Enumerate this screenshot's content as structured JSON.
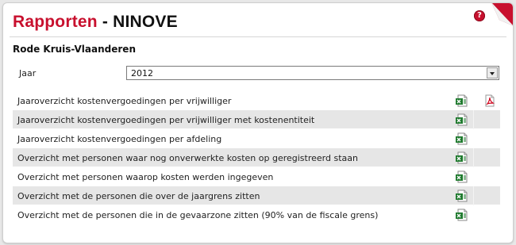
{
  "header": {
    "title_main": "Rapporten",
    "title_separator": "-",
    "title_location": "NINOVE"
  },
  "organization": "Rode Kruis-Vlaanderen",
  "filter": {
    "year_label": "Jaar",
    "year_value": "2012"
  },
  "reports": [
    {
      "label": "Jaaroverzicht kostenvergoedingen per vrijwilliger",
      "excel": true,
      "pdf": true
    },
    {
      "label": "Jaaroverzicht kostenvergoedingen per vrijwilliger met kostenentiteit",
      "excel": true,
      "pdf": false
    },
    {
      "label": "Jaaroverzicht kostenvergoedingen per afdeling",
      "excel": true,
      "pdf": false
    },
    {
      "label": "Overzicht met personen waar nog onverwerkte kosten op geregistreerd staan",
      "excel": true,
      "pdf": false
    },
    {
      "label": "Overzicht met personen waarop kosten werden ingegeven",
      "excel": true,
      "pdf": false
    },
    {
      "label": "Overzicht met de personen die over de jaargrens zitten",
      "excel": true,
      "pdf": false
    },
    {
      "label": "Overzicht met de personen die in de gevaarzone zitten (90% van de fiscale grens)",
      "excel": true,
      "pdf": false
    }
  ],
  "icons": {
    "help": "help-icon",
    "excel": "excel-icon",
    "pdf": "pdf-icon"
  },
  "colors": {
    "brand_red": "#c8102e",
    "row_alt": "#e6e6e6",
    "excel_green": "#1f7a2e",
    "pdf_red": "#d0021b"
  }
}
